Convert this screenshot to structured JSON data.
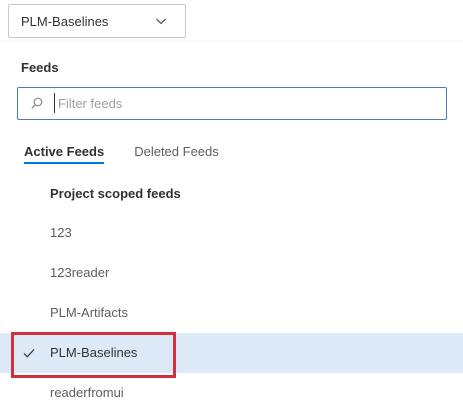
{
  "feed_picker": {
    "selected": "PLM-Baselines",
    "icon": "chevron-down-icon"
  },
  "panel": {
    "section_label": "Feeds",
    "filter": {
      "placeholder": "Filter feeds",
      "value": "",
      "icon": "search-icon"
    },
    "tabs": [
      {
        "label": "Active Feeds",
        "active": true
      },
      {
        "label": "Deleted Feeds",
        "active": false
      }
    ],
    "group_header": "Project scoped feeds",
    "items": [
      {
        "label": "123",
        "selected": false
      },
      {
        "label": "123reader",
        "selected": false
      },
      {
        "label": "PLM-Artifacts",
        "selected": false
      },
      {
        "label": "PLM-Baselines",
        "selected": true,
        "icon": "check-icon"
      },
      {
        "label": "readerfromui",
        "selected": false
      }
    ]
  },
  "colors": {
    "accent": "#0078d4",
    "selected_row": "#dceaf7",
    "highlight_box": "#d32f3f"
  }
}
